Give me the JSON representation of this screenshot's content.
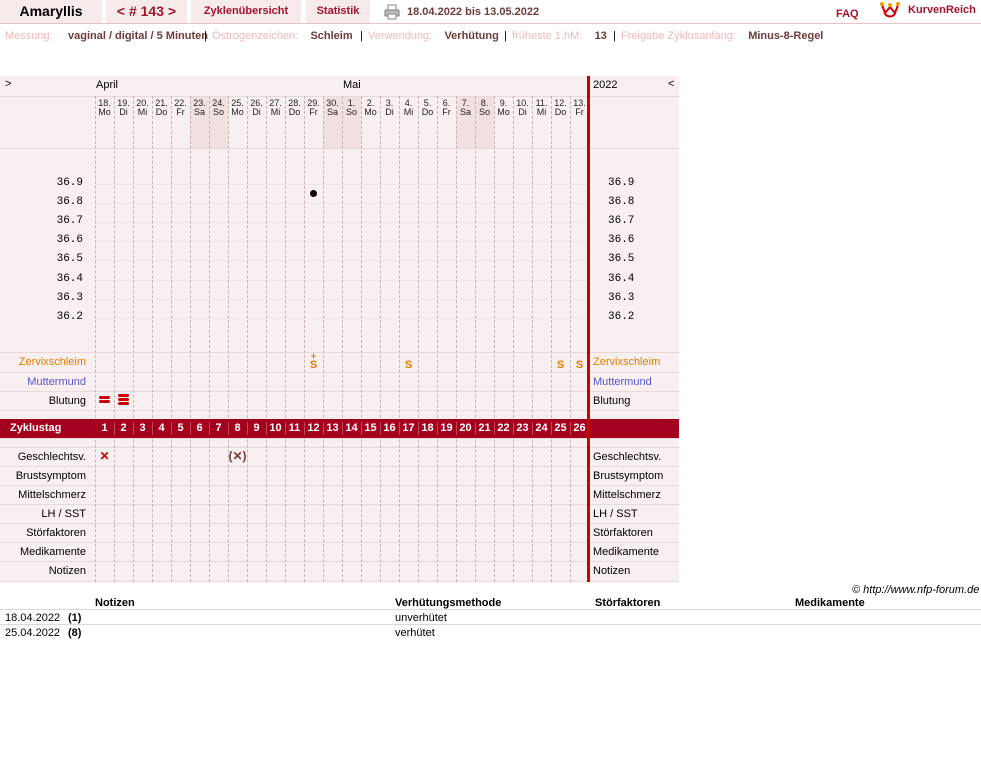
{
  "header": {
    "cycle_name": "Amaryllis",
    "cycle_nav": "< # 143 >",
    "tab_overview": "Zyklenübersicht",
    "tab_stats": "Statistik",
    "date_range": "18.04.2022 bis 13.05.2022",
    "faq": "FAQ",
    "brand": "KurvenReich"
  },
  "info": [
    {
      "label": "Messung:",
      "value": "vaginal / digital / 5 Minuten"
    },
    {
      "label": "Östrogenzeichen:",
      "value": "Schleim"
    },
    {
      "label": "Verwendung:",
      "value": "Verhütung"
    },
    {
      "label": "früheste 1.hM:",
      "value": "13"
    },
    {
      "label": "Freigabe Zyklusanfang:",
      "value": "Minus-8-Regel"
    }
  ],
  "chart": {
    "nav_left": ">",
    "nav_right": "<",
    "months": [
      {
        "label": "April",
        "start_index": 0
      },
      {
        "label": "Mai",
        "start_index": 13
      }
    ],
    "year": "2022",
    "days": [
      {
        "d": "18.",
        "w": "Mo"
      },
      {
        "d": "19.",
        "w": "Di"
      },
      {
        "d": "20.",
        "w": "Mi"
      },
      {
        "d": "21.",
        "w": "Do"
      },
      {
        "d": "22.",
        "w": "Fr"
      },
      {
        "d": "23.",
        "w": "Sa"
      },
      {
        "d": "24.",
        "w": "So"
      },
      {
        "d": "25.",
        "w": "Mo"
      },
      {
        "d": "26.",
        "w": "Di"
      },
      {
        "d": "27.",
        "w": "Mi"
      },
      {
        "d": "28.",
        "w": "Do"
      },
      {
        "d": "29.",
        "w": "Fr"
      },
      {
        "d": "30.",
        "w": "Sa"
      },
      {
        "d": "1.",
        "w": "So"
      },
      {
        "d": "2.",
        "w": "Mo"
      },
      {
        "d": "3.",
        "w": "Di"
      },
      {
        "d": "4.",
        "w": "Mi"
      },
      {
        "d": "5.",
        "w": "Do"
      },
      {
        "d": "6.",
        "w": "Fr"
      },
      {
        "d": "7.",
        "w": "Sa"
      },
      {
        "d": "8.",
        "w": "So"
      },
      {
        "d": "9.",
        "w": "Mo"
      },
      {
        "d": "10.",
        "w": "Di"
      },
      {
        "d": "11.",
        "w": "Mi"
      },
      {
        "d": "12.",
        "w": "Do"
      },
      {
        "d": "13.",
        "w": "Fr"
      }
    ],
    "temp_ticks": [
      "36.9",
      "36.8",
      "36.7",
      "36.6",
      "36.5",
      "36.4",
      "36.3",
      "36.2"
    ],
    "temperatures": [
      {
        "day": 12,
        "value": 36.85
      }
    ],
    "rows": {
      "zervix": "Zervixschleim",
      "muttermund": "Muttermund",
      "blutung": "Blutung",
      "zyklustag": "Zyklustag",
      "geschlecht": "Geschlechtsv.",
      "brust": "Brustsymptom",
      "mittel": "Mittelschmerz",
      "lh": "LH / SST",
      "stoer": "Störfaktoren",
      "medi": "Medikamente",
      "notizen": "Notizen"
    },
    "zervix_marks": [
      {
        "day": 12,
        "symbol": "S",
        "plus": "+"
      },
      {
        "day": 17,
        "symbol": "S",
        "plus": ""
      },
      {
        "day": 25,
        "symbol": "S",
        "plus": ""
      },
      {
        "day": 26,
        "symbol": "S",
        "plus": ""
      }
    ],
    "bleeding": [
      {
        "day": 1,
        "level": 2
      },
      {
        "day": 2,
        "level": 3
      }
    ],
    "intercourse": [
      {
        "day": 1,
        "symbol": "✕"
      },
      {
        "day": 8,
        "symbol": "(✕)"
      }
    ],
    "cycle_days": [
      "1",
      "2",
      "3",
      "4",
      "5",
      "6",
      "7",
      "8",
      "9",
      "10",
      "11",
      "12",
      "13",
      "14",
      "15",
      "16",
      "17",
      "18",
      "19",
      "20",
      "21",
      "22",
      "23",
      "24",
      "25",
      "26"
    ],
    "weekend_days": [
      6,
      7,
      13,
      14,
      20,
      21
    ],
    "copyright": "© http://www.nfp-forum.de"
  },
  "notes": {
    "headers": [
      "Notizen",
      "Verhütungsmethode",
      "Störfaktoren",
      "Medikamente"
    ],
    "rows": [
      {
        "date": "18.04.2022",
        "day": "(1)",
        "note": "",
        "method": "unverhütet",
        "stoer": "",
        "medi": ""
      },
      {
        "date": "25.04.2022",
        "day": "(8)",
        "note": "",
        "method": "verhütet",
        "stoer": "",
        "medi": ""
      }
    ]
  },
  "colors": {
    "brand_red": "#a4001d",
    "tab_bg": "#f7eaea",
    "zervix_orange": "#e07b00",
    "muttermund_blue": "#5555cc",
    "chart_bg": "#f8f0f0"
  }
}
